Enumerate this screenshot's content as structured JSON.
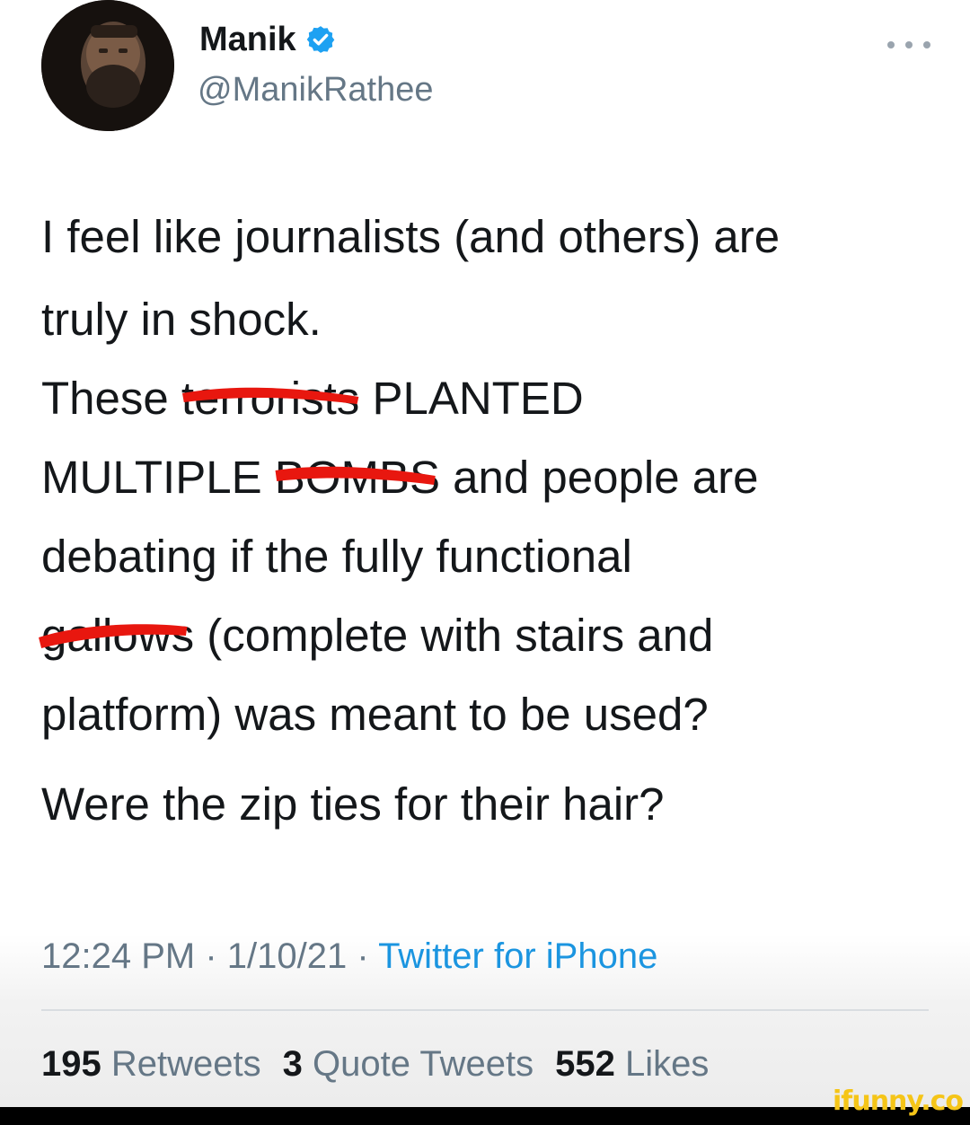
{
  "user": {
    "name": "Manik",
    "handle": "@ManikRathee",
    "verified_icon": "verified-badge-icon"
  },
  "tweet": {
    "line1": "I feel like journalists (and others) are",
    "line2": "truly in shock.",
    "p2_1a": "These ",
    "p2_1redact": "terrorists",
    "p2_1b": " PLANTED",
    "p2_2a": "MULTIPLE ",
    "p2_2redact": "BOMBS",
    "p2_2b": " and people are",
    "p2_3": "debating if the fully functional",
    "p2_4redact": "gallows",
    "p2_4b": " (complete with stairs and",
    "p2_5": "platform) was meant to be used?",
    "p3": "Were the zip ties for their hair?"
  },
  "meta": {
    "time": "12:24 PM",
    "sep1": " · ",
    "date": "1/10/21",
    "sep2": " · ",
    "app": "Twitter for iPhone"
  },
  "stats": {
    "retweets_count": "195",
    "retweets_label": "Retweets",
    "quotes_count": "3",
    "quotes_label": "Quote Tweets",
    "likes_count": "552",
    "likes_label": "Likes"
  },
  "watermark": "ifunny.co",
  "colors": {
    "text": "#14171a",
    "muted": "#657786",
    "link": "#1b95e0",
    "redaction": "#e8170f",
    "verified": "#1da1f2"
  }
}
